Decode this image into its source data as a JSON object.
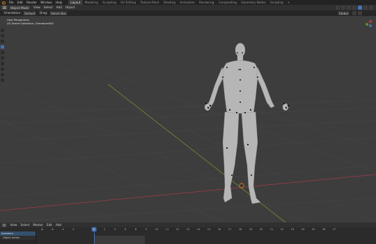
{
  "menu": {
    "items": [
      "File",
      "Edit",
      "Render",
      "Window",
      "Help"
    ],
    "workspaces": [
      "Layout",
      "Modeling",
      "Sculpting",
      "UV Editing",
      "Texture Paint",
      "Shading",
      "Animation",
      "Rendering",
      "Compositing",
      "Geometry Nodes",
      "Scripting"
    ],
    "active_workspace": "Layout",
    "add_label": "+"
  },
  "header": {
    "mode": "Object Mode",
    "view": "View",
    "select": "Select",
    "add": "Add",
    "object": "Object"
  },
  "tool_header": {
    "orientation_label": "Orientation:",
    "orientation_value": "Default",
    "drag_label": "Drag:",
    "drag_value": "Select Box",
    "pivot": "Global"
  },
  "viewport": {
    "perspective": "User Perspective",
    "collection": "(0) Scene Collection | Armature002",
    "colors": {
      "background": "#3d3d3d",
      "grid": "#464646",
      "x_axis": "#9b3b46",
      "y_axis": "#7f8a2e",
      "figure": "#b6b6b6"
    }
  },
  "timeline": {
    "menu": [
      "View",
      "Select",
      "Marker",
      "Edit",
      "Add"
    ],
    "current_frame": "0",
    "ticks": [
      "-8",
      "-6",
      "-4",
      "-2",
      "0",
      "2",
      "4",
      "6",
      "8",
      "9",
      "10",
      "11",
      "12",
      "13",
      "14",
      "15",
      "16",
      "17",
      "18",
      "19",
      "20",
      "21",
      "22",
      "23",
      "24",
      "25",
      "26",
      "27"
    ],
    "rows": [
      "Armature",
      "Object Action"
    ]
  }
}
